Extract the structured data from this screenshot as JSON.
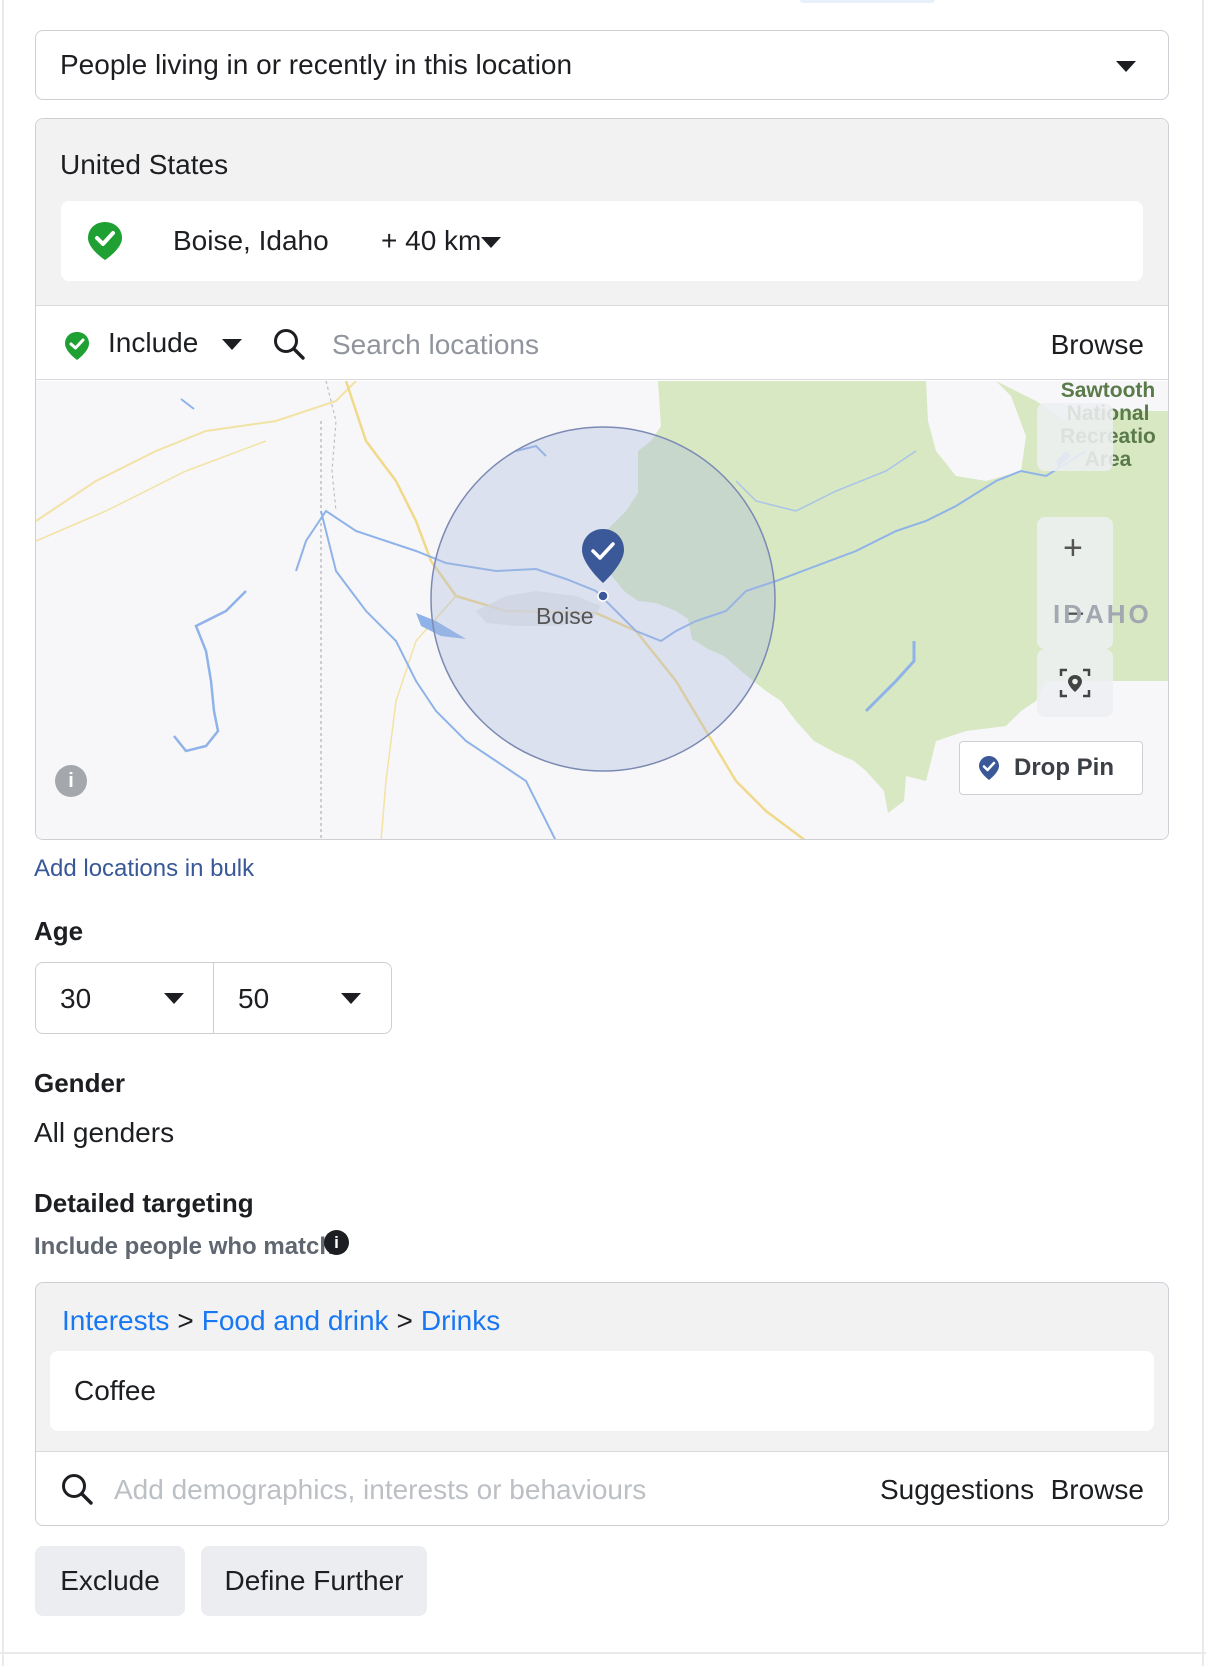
{
  "location_type": {
    "selected": "People living in or recently in this location"
  },
  "locations": {
    "country": "United States",
    "selected_place": "Boise, Idaho",
    "radius": "+ 40 km"
  },
  "location_search": {
    "mode": "Include",
    "placeholder": "Search locations",
    "browse_label": "Browse"
  },
  "map": {
    "city_label": "Boise",
    "state_label": "IDAHO",
    "area_label_lines": [
      "Sawtooth",
      "National",
      "Recreatio",
      "Area"
    ],
    "zoom_in": "+",
    "zoom_out": "−",
    "drop_pin_label": "Drop Pin",
    "info_glyph": "i"
  },
  "bulk_link": "Add locations in bulk",
  "age": {
    "title": "Age",
    "min": "30",
    "max": "50"
  },
  "gender": {
    "title": "Gender",
    "value": "All genders"
  },
  "detailed_targeting": {
    "title": "Detailed targeting",
    "subtitle": "Include people who match",
    "breadcrumb": [
      "Interests",
      "Food and drink",
      "Drinks"
    ],
    "breadcrumb_separator": ">",
    "selected_item": "Coffee",
    "search_placeholder": "Add demographics, interests or behaviours",
    "suggestions_label": "Suggestions",
    "browse_label": "Browse"
  },
  "actions": {
    "exclude_label": "Exclude",
    "define_further_label": "Define Further"
  },
  "colors": {
    "include_green": "#1fa032",
    "link_blue": "#1877f2",
    "pin_blue": "#3b5998",
    "forest_green": "#d7e8c3"
  },
  "icons": [
    "chevron-down-icon",
    "location-pin-icon",
    "search-icon",
    "zoom-in-icon",
    "zoom-out-icon",
    "recenter-icon",
    "info-icon"
  ]
}
